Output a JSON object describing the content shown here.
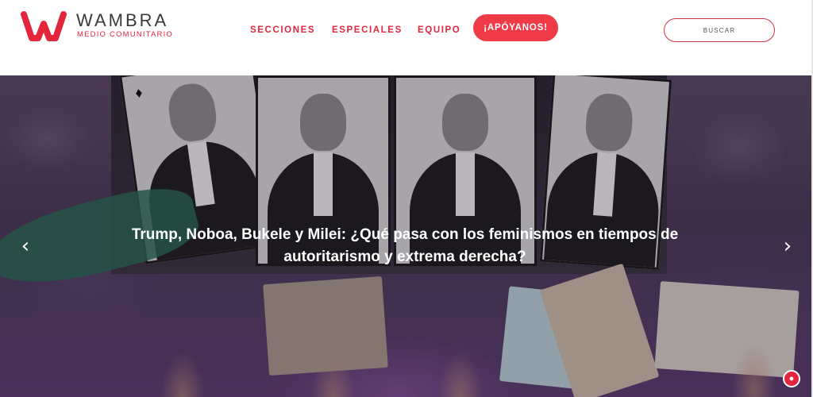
{
  "brand": {
    "name": "WAMBRA",
    "tagline": "MEDIO COMUNITARIO",
    "accent": "#e3263c"
  },
  "nav": {
    "items": [
      "SECCIONES",
      "ESPECIALES",
      "EQUIPO"
    ],
    "support_label": "¡APÓYANOS!",
    "search_label": "BUSCAR"
  },
  "hero": {
    "headline": "Trump, Noboa, Bukele y Milei: ¿Qué pasa con los feminismos en tiempos de autoritarismo y extrema derecha?",
    "prev_icon": "chevron-left-icon",
    "next_icon": "chevron-right-icon"
  },
  "notification": {
    "icon": "bell-icon"
  }
}
